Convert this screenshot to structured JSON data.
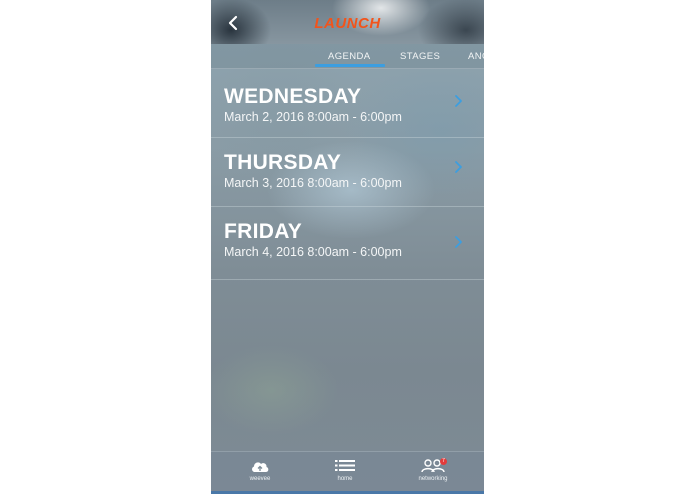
{
  "header": {
    "logo_text": "LAUNCH",
    "back_icon": "chevron-left-icon"
  },
  "tabs": [
    {
      "label": "AGENDA",
      "active": true
    },
    {
      "label": "STAGES",
      "active": false
    },
    {
      "label": "ANO",
      "active": false
    }
  ],
  "accent_color": "#3c9ee0",
  "brand_color": "#f2541b",
  "days": [
    {
      "name": "WEDNESDAY",
      "date": "March 2, 2016  8:00am - 6:00pm"
    },
    {
      "name": "THURSDAY",
      "date": "March 3, 2016  8:00am - 6:00pm"
    },
    {
      "name": "FRIDAY",
      "date": "March 4, 2016  8:00am - 6:00pm"
    }
  ],
  "bottom_nav": [
    {
      "label": "weevee",
      "icon": "cloud-upload-icon"
    },
    {
      "label": "home",
      "icon": "list-icon"
    },
    {
      "label": "networking",
      "icon": "people-icon",
      "badge": "7"
    }
  ]
}
